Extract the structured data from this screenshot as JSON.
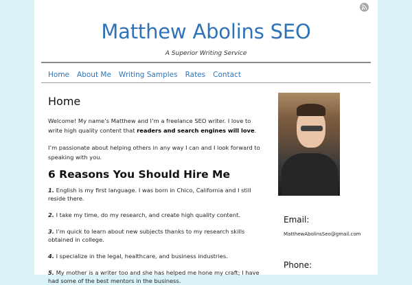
{
  "site": {
    "title": "Matthew Abolins SEO",
    "tagline": "A Superior Writing Service",
    "rss_icon": "rss-icon"
  },
  "nav": {
    "items": [
      "Home",
      "About Me",
      "Writing Samples",
      "Rates",
      "Contact"
    ]
  },
  "main": {
    "heading": "Home",
    "intro_part1": "Welcome! My name’s Matthew and I’m a freelance SEO writer. I love to write high quality content that ",
    "intro_bold": "readers and search engines will love",
    "intro_end": ".",
    "para2": "I’m passionate about helping others in any way I can and I look forward to speaking with you.",
    "reasons_heading": "6 Reasons You Should Hire Me",
    "reasons": [
      {
        "num": "1.",
        "text": " English is my first language. I was born in Chico, California and I still reside there."
      },
      {
        "num": "2.",
        "text": " I take my time, do my research, and create high quality content."
      },
      {
        "num": "3.",
        "text": " I’m quick to learn about new subjects thanks to my research skills obtained in college."
      },
      {
        "num": "4.",
        "text": " I specialize in the legal, healthcare, and business industries."
      },
      {
        "num": "5.",
        "text": " My mother is a writer too and she has helped me hone my craft; I have had some of the best mentors in the business."
      }
    ]
  },
  "sidebar": {
    "email_heading": "Email:",
    "email": "MatthewAbolinsSeo@gmail.com",
    "phone_heading": "Phone:"
  }
}
